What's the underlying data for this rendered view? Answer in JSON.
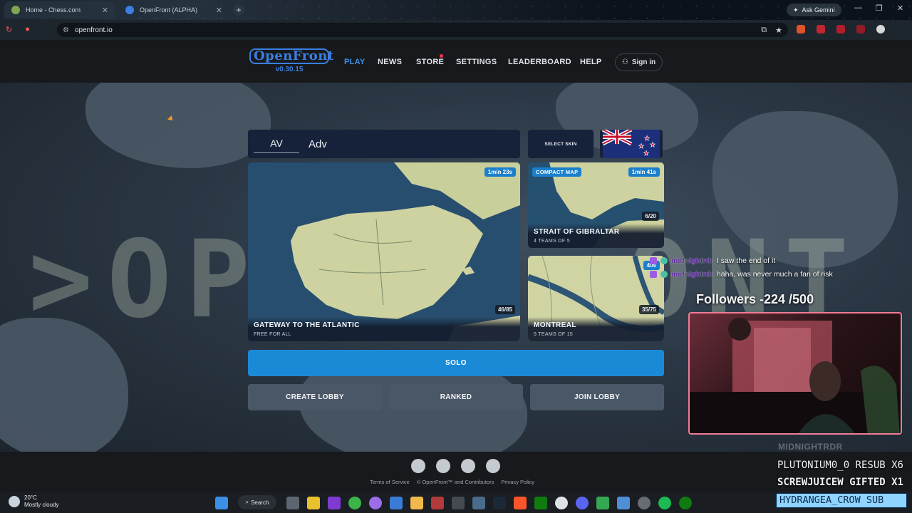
{
  "browser": {
    "tabs": [
      {
        "label": "Home - Chess.com",
        "active": false
      },
      {
        "label": "OpenFront (ALPHA)",
        "active": true
      }
    ],
    "new_tab": "+",
    "ask_gemini": "Ask Gemini",
    "url": "openfront.io"
  },
  "header": {
    "logo": "OpenFront",
    "version": "v0.30.15",
    "nav": [
      "PLAY",
      "NEWS",
      "STORE",
      "SETTINGS",
      "LEADERBOARD",
      "HELP"
    ],
    "active_nav": "PLAY",
    "sign_in": "Sign in"
  },
  "background_text": {
    "left": ">OP",
    "right": "ONT"
  },
  "form": {
    "clan_tag": "AV",
    "username": "Adv",
    "select_skin": "SELECT SKIN"
  },
  "lobbies": [
    {
      "title": "GATEWAY TO THE ATLANTIC",
      "subtitle": "FREE FOR ALL",
      "timer": "1min 23s",
      "players": "46/85"
    },
    {
      "title": "STRAIT OF GIBRALTAR",
      "subtitle": "4 TEAMS OF 5",
      "timer": "1min 41s",
      "players": "6/20",
      "badge": "COMPACT MAP"
    },
    {
      "title": "MONTREAL",
      "subtitle": "5 TEAMS OF 15",
      "timer": "40s",
      "players": "35/75"
    }
  ],
  "buttons": {
    "solo": "SOLO",
    "create_lobby": "CREATE LOBBY",
    "ranked": "RANKED",
    "join_lobby": "JOIN LOBBY"
  },
  "footer": {
    "social_icons": [
      "github-icon",
      "reddit-icon",
      "discord-icon",
      "globe-icon"
    ],
    "terms": "Terms of Service",
    "copyright": "© OpenFront™ and Contributors",
    "privacy": "Privacy Policy"
  },
  "overlay": {
    "chat": [
      {
        "user": "midnightrdr",
        "message": "I saw the end of it"
      },
      {
        "user": "midnightrdr",
        "message": "haha, was never much a fan of risk"
      }
    ],
    "followers": "Followers -224 /500",
    "cam_name": "MIDNIGHTRDR",
    "ticker1": "PLUTONIUM0_0  RESUB X6",
    "ticker2": "SCREWJUICEW  GIFTED X1",
    "ticker3": "HYDRANGEA_CROW SUB"
  },
  "taskbar": {
    "temperature": "20°C",
    "weather": "Mostly cloudy",
    "search": "Search"
  },
  "colors": {
    "accent_blue": "#1b8ad6",
    "nav_active": "#3f92ea",
    "panel_navy": "#16213a",
    "button_gray": "#4a5766"
  }
}
